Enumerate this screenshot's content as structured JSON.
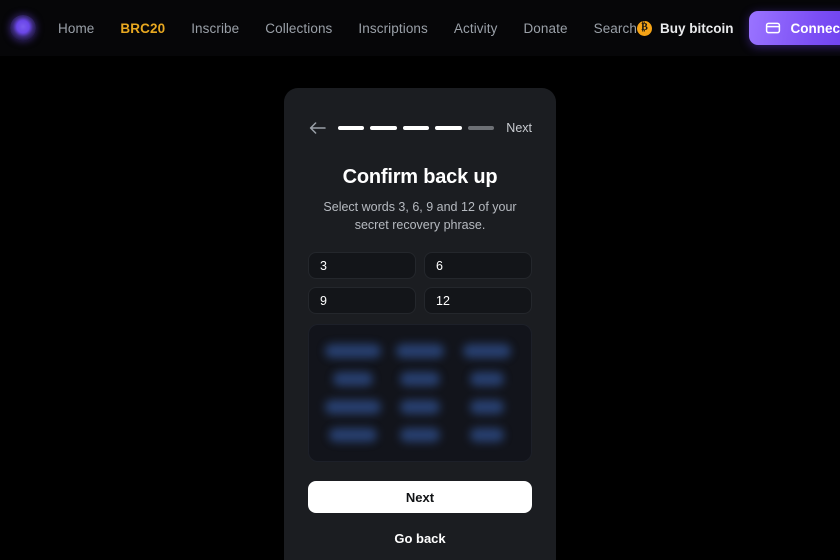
{
  "colors": {
    "page_background": "#000000",
    "navbar_background": "#060608",
    "modal_background": "#1b1d21",
    "accent_active_nav": "#e8a820",
    "brand_purple": "#7c4ff5",
    "bitcoin_orange": "#f5a316",
    "input_background": "#131519",
    "chips_background": "#12141b",
    "chip_color": "#2a4478",
    "primary_button_background": "#ffffff"
  },
  "navbar": {
    "logo_icon": "orb-logo-icon",
    "links": [
      {
        "label": "Home",
        "active": false
      },
      {
        "label": "BRC20",
        "active": true
      },
      {
        "label": "Inscribe",
        "active": false
      },
      {
        "label": "Collections",
        "active": false
      },
      {
        "label": "Inscriptions",
        "active": false
      },
      {
        "label": "Activity",
        "active": false
      },
      {
        "label": "Donate",
        "active": false
      },
      {
        "label": "Search",
        "active": false
      }
    ],
    "buy_bitcoin": {
      "label": "Buy bitcoin",
      "icon": "bitcoin-icon",
      "icon_glyph": "₿"
    },
    "connect_wallet": {
      "label": "Connect Wallet",
      "icon": "wallet-icon"
    }
  },
  "modal": {
    "back_icon": "arrow-left-icon",
    "next_link_label": "Next",
    "steps": {
      "total": 5,
      "completed": 4,
      "segments": [
        true,
        true,
        true,
        true,
        false
      ]
    },
    "title": "Confirm back up",
    "subtitle": "Select words 3, 6, 9 and 12 of your secret recovery phrase.",
    "word_inputs": [
      {
        "name": "word-input-3",
        "value": "3",
        "placeholder": "3"
      },
      {
        "name": "word-input-6",
        "value": "6",
        "placeholder": "6"
      },
      {
        "name": "word-input-9",
        "value": "9",
        "placeholder": "9"
      },
      {
        "name": "word-input-12",
        "value": "12",
        "placeholder": "12"
      }
    ],
    "word_chips": {
      "columns": 3,
      "rows": 4,
      "obscured": true,
      "widths": [
        "w1",
        "w2",
        "w2",
        "w3",
        "w3",
        "w4",
        "w1",
        "w3",
        "w4",
        "w2",
        "w3",
        "w4"
      ]
    },
    "primary_button_label": "Next",
    "secondary_button_label": "Go back"
  }
}
